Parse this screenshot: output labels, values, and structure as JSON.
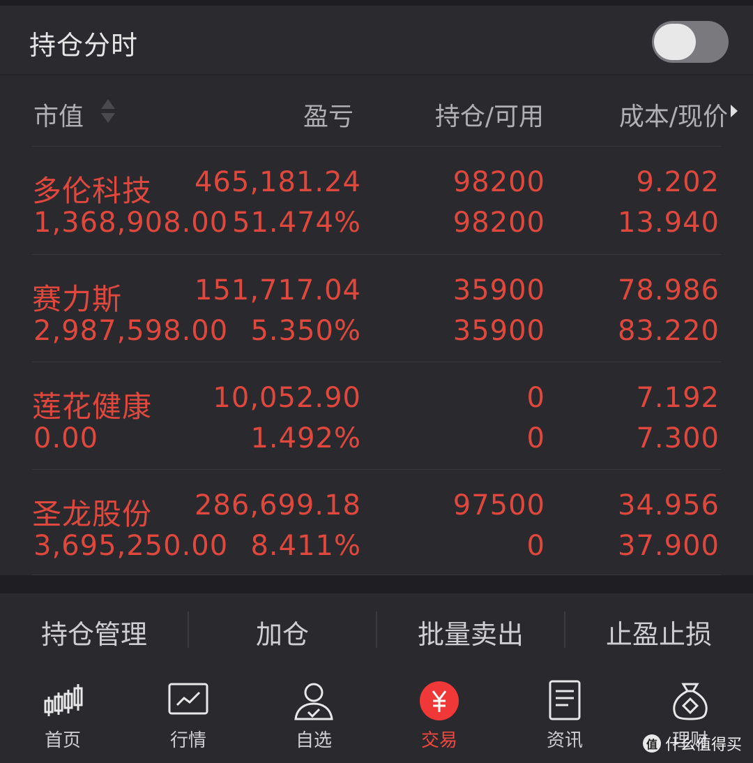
{
  "topbar": {
    "title": "持仓分时"
  },
  "header": {
    "market_value": "市值",
    "profit_loss": "盈亏",
    "position": "持仓/可用",
    "cost": "成本/现价"
  },
  "holdings": [
    {
      "name": "多伦科技",
      "profit": "465,181.24",
      "position": "98200",
      "cost": "9.202",
      "market_value": "1,368,908.00",
      "profit_rate": "51.474%",
      "available": "98200",
      "price": "13.940"
    },
    {
      "name": "赛力斯",
      "profit": "151,717.04",
      "position": "35900",
      "cost": "78.986",
      "market_value": "2,987,598.00",
      "profit_rate": "5.350%",
      "available": "35900",
      "price": "83.220"
    },
    {
      "name": "莲花健康",
      "profit": "10,052.90",
      "position": "0",
      "cost": "7.192",
      "market_value": "0.00",
      "profit_rate": "1.492%",
      "available": "0",
      "price": "7.300"
    },
    {
      "name": "圣龙股份",
      "profit": "286,699.18",
      "position": "97500",
      "cost": "34.956",
      "market_value": "3,695,250.00",
      "profit_rate": "8.411%",
      "available": "0",
      "price": "37.900"
    }
  ],
  "actions": {
    "manage": "持仓管理",
    "add": "加仓",
    "batch_sell": "批量卖出",
    "stop": "止盈止损"
  },
  "nav": {
    "home": "首页",
    "market": "行情",
    "watchlist": "自选",
    "trade": "交易",
    "news": "资讯",
    "finance": "理财"
  },
  "watermark": {
    "badge": "值",
    "text": "什么值得买"
  },
  "colors": {
    "up": "#e0483e",
    "background": "#2a2a2e",
    "accent": "#f0483e"
  }
}
